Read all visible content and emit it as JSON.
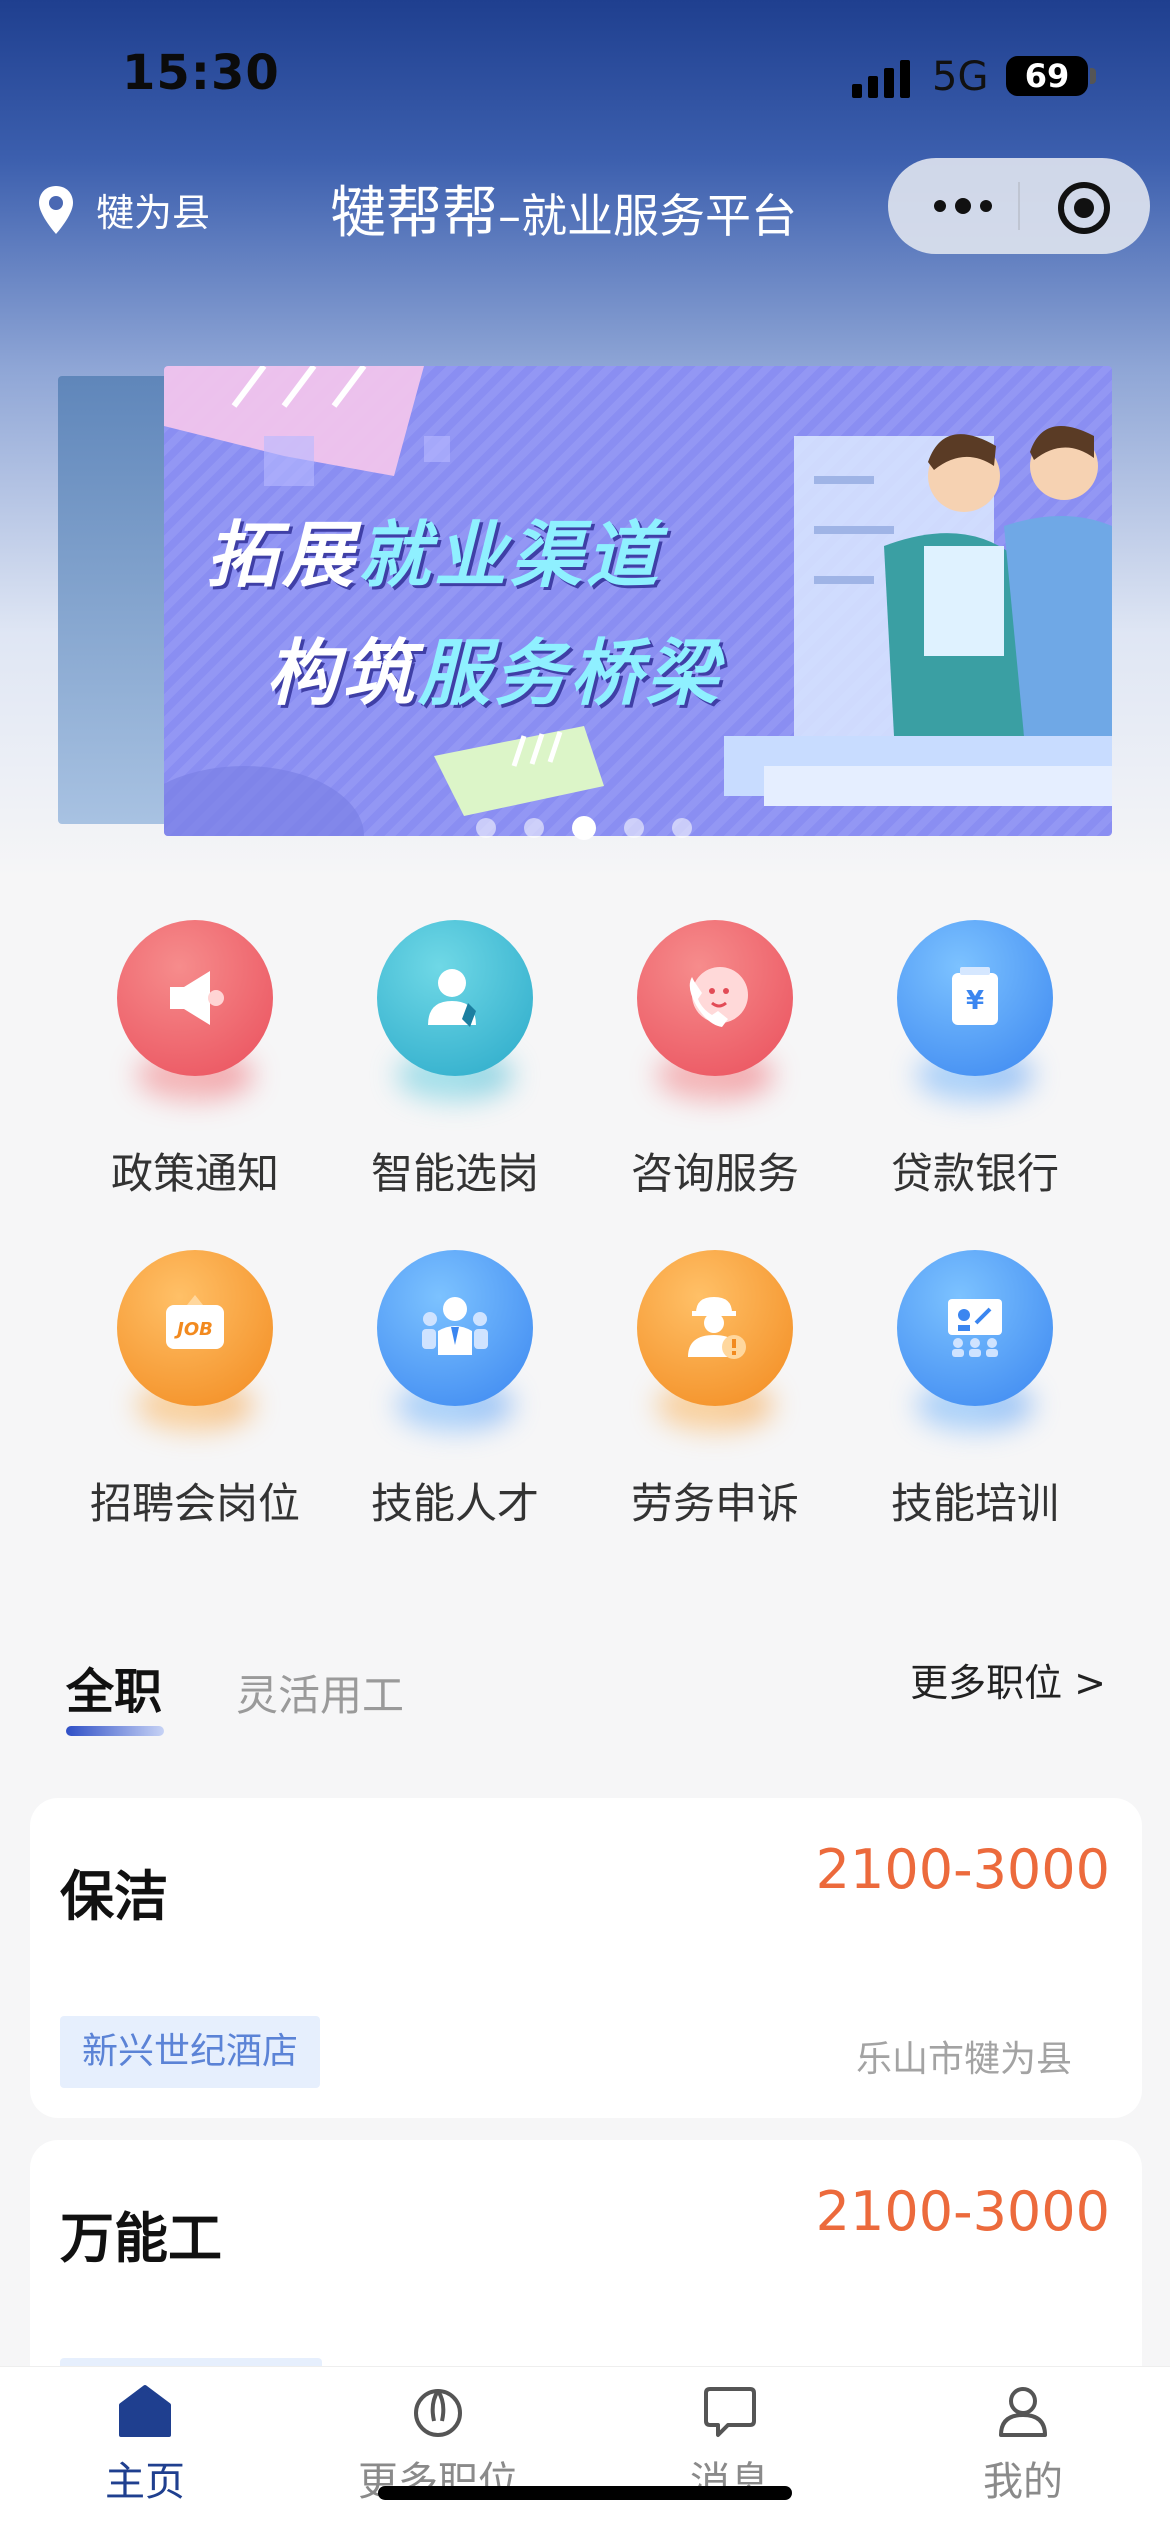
{
  "status_bar": {
    "time": "15:30",
    "network": "5G",
    "battery": "69"
  },
  "nav": {
    "location": "犍为县",
    "title": "犍帮帮",
    "subtitle": "–就业服务平台",
    "more_icon": "more-dots-icon",
    "target_icon": "target-icon"
  },
  "banner": {
    "line1_a": "拓展",
    "line1_b": "就业渠道",
    "line2_a": "构筑",
    "line2_b": "服务桥梁",
    "dots": 5,
    "active_dot": 3
  },
  "services": [
    {
      "label": "政策通知",
      "icon": "megaphone-icon",
      "color": "red"
    },
    {
      "label": "智能选岗",
      "icon": "person-tie-icon",
      "color": "teal"
    },
    {
      "label": "咨询服务",
      "icon": "phone-chat-icon",
      "color": "red"
    },
    {
      "label": "贷款银行",
      "icon": "yuan-box-icon",
      "color": "blue"
    },
    {
      "label": "招聘会岗位",
      "icon": "job-sign-icon",
      "color": "orange"
    },
    {
      "label": "技能人才",
      "icon": "talent-group-icon",
      "color": "blue"
    },
    {
      "label": "劳务申诉",
      "icon": "worker-alert-icon",
      "color": "orange"
    },
    {
      "label": "技能培训",
      "icon": "training-board-icon",
      "color": "blue"
    }
  ],
  "tabs": {
    "active": "全职",
    "inactive": "灵活用工",
    "more": "更多职位 >"
  },
  "jobs": [
    {
      "title": "保洁",
      "salary": "2100-3000",
      "company": "新兴世纪酒店",
      "location": "乐山市犍为县"
    },
    {
      "title": "万能工",
      "salary": "2100-3000",
      "company": "",
      "location": ""
    }
  ],
  "tabbar": [
    {
      "label": "主页",
      "icon": "home-icon",
      "active": true
    },
    {
      "label": "更多职位",
      "icon": "jobs-icon",
      "active": false
    },
    {
      "label": "消息",
      "icon": "message-icon",
      "active": false
    },
    {
      "label": "我的",
      "icon": "profile-icon",
      "active": false
    }
  ],
  "colors": {
    "primary": "#1f3f8f",
    "salary": "#ec6a3c",
    "company_tag": "#5b83d6"
  }
}
